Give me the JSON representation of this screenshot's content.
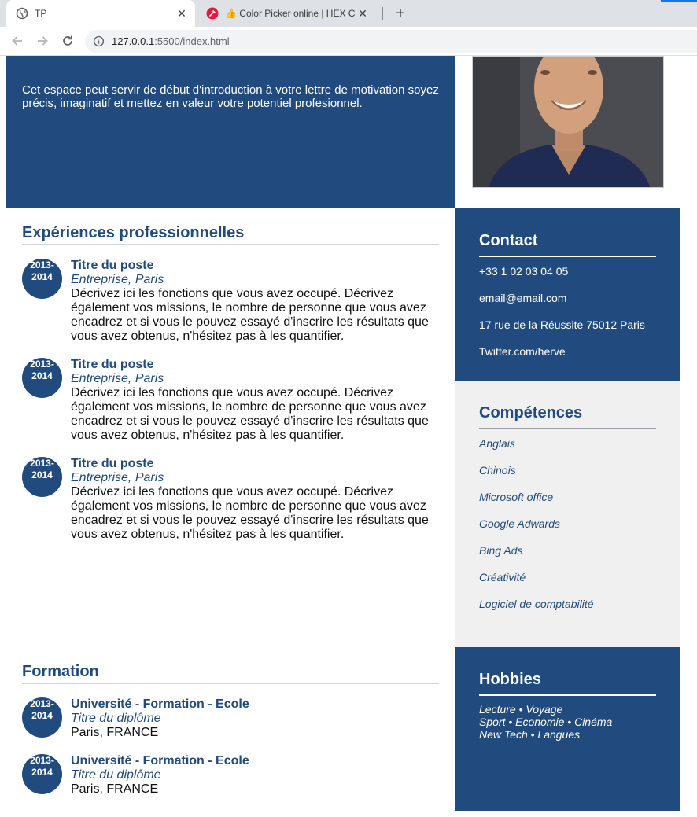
{
  "browser": {
    "tabs": [
      {
        "title": "TP",
        "active": true
      },
      {
        "title": "👍 Color Picker online | HEX Colo",
        "active": false
      }
    ],
    "url_host": "127.0.0.1",
    "url_rest": ":5500/index.html",
    "accent": "#1a73e8"
  },
  "cv": {
    "brand_color": "#214b7f",
    "intro": "Cet espace peut servir de début d'introduction à votre lettre de motivation soyez précis, imaginatif et mettez en valeur votre potentiel profesionnel.",
    "experience": {
      "title": "Expériences professionnelles",
      "jobs": [
        {
          "year_start": "2013-",
          "year_end": "2014",
          "position": "Titre du poste",
          "company": "Entreprise, Paris",
          "description": "Décrivez ici les fonctions que vous avez occupé. Décrivez également vos missions, le nombre de personne que vous avez encadrez et si vous le pouvez essayé d'inscrire les résultats que vous avez obtenus, n'hésitez pas à les quantifier."
        },
        {
          "year_start": "2013-",
          "year_end": "2014",
          "position": "Titre du poste",
          "company": "Entreprise, Paris",
          "description": "Décrivez ici les fonctions que vous avez occupé. Décrivez également vos missions, le nombre de personne que vous avez encadrez et si vous le pouvez essayé d'inscrire les résultats que vous avez obtenus, n'hésitez pas à les quantifier."
        },
        {
          "year_start": "2013-",
          "year_end": "2014",
          "position": "Titre du poste",
          "company": "Entreprise, Paris",
          "description": "Décrivez ici les fonctions que vous avez occupé. Décrivez également vos missions, le nombre de personne que vous avez encadrez et si vous le pouvez essayé d'inscrire les résultats que vous avez obtenus, n'hésitez pas à les quantifier."
        }
      ]
    },
    "formation": {
      "title": "Formation",
      "items": [
        {
          "year_start": "2013-",
          "year_end": "2014",
          "school": "Université - Formation - Ecole",
          "degree": "Titre du diplôme",
          "place": "Paris, FRANCE"
        },
        {
          "year_start": "2013-",
          "year_end": "2014",
          "school": "Université - Formation - Ecole",
          "degree": "Titre du diplôme",
          "place": "Paris, FRANCE"
        }
      ]
    },
    "contact": {
      "title": "Contact",
      "phone": "+33 1 02 03 04 05",
      "email": "email@email.com",
      "address": "17 rue de la Réussite 75012 Paris",
      "twitter": "Twitter.com/herve"
    },
    "skills": {
      "title": "Compétences",
      "items": [
        "Anglais",
        "Chinois",
        "Microsoft office",
        "Google Adwards",
        "Bing Ads",
        "Créativité",
        "Logiciel de comptabilité"
      ]
    },
    "hobbies": {
      "title": "Hobbies",
      "lines": [
        "Lecture • Voyage",
        "Sport • Economie • Cinéma",
        "New Tech • Langues"
      ]
    }
  }
}
